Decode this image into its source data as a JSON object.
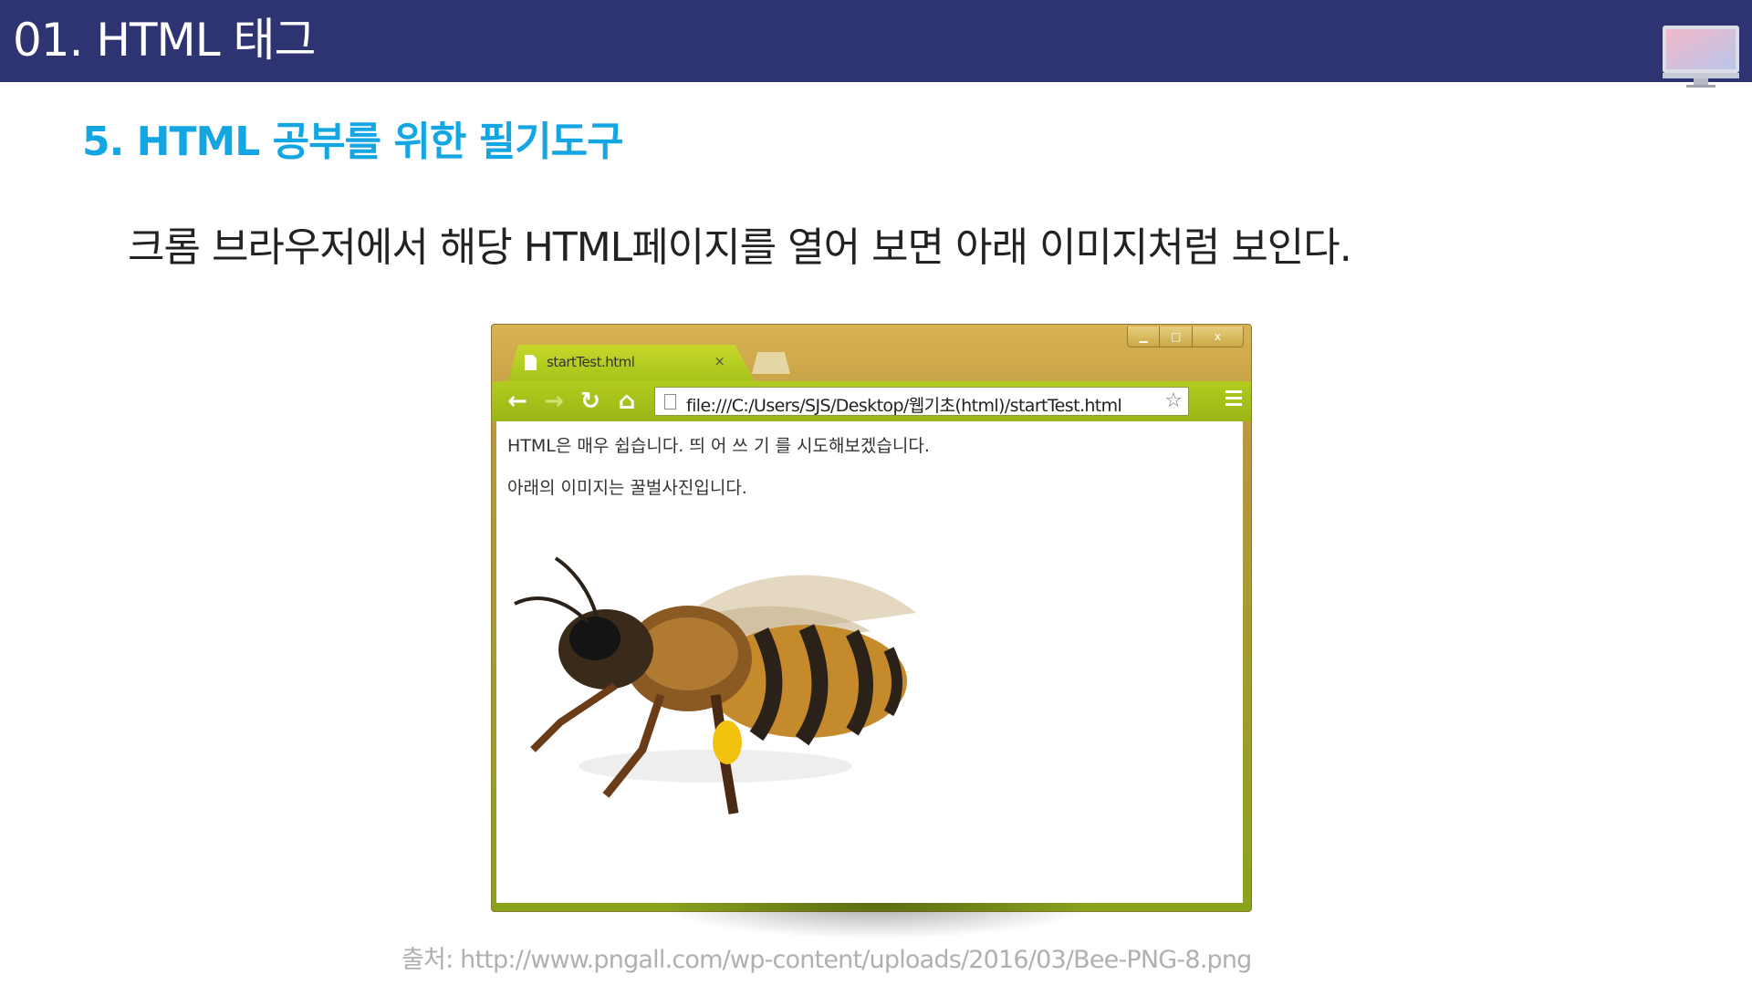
{
  "header": {
    "title": "01. HTML 태그",
    "icon": "monitor-icon"
  },
  "section": {
    "title": "5. HTML 공부를 위한 필기도구",
    "description": "크롬 브라우저에서 해당 HTML페이지를 열어 보면 아래 이미지처럼 보인다."
  },
  "browser": {
    "tab_label": "startTest.html",
    "tab_close": "×",
    "url": "file:///C:/Users/SJS/Desktop/웹기초(html)/startTest.html",
    "window_controls": [
      "▁",
      "□",
      "x"
    ],
    "content_lines": [
      "HTML은 매우 쉽습니다. 띄 어 쓰 기 를 시도해보겠습니다.",
      "아래의 이미지는 꿀벌사진입니다."
    ],
    "image": "bee-image",
    "accent_color": "#a5c21a"
  },
  "source": "출처: http://www.pngall.com/wp-content/uploads/2016/03/Bee-PNG-8.png",
  "colors": {
    "header_bg": "#2e3472",
    "section_title": "#14a6e3"
  }
}
